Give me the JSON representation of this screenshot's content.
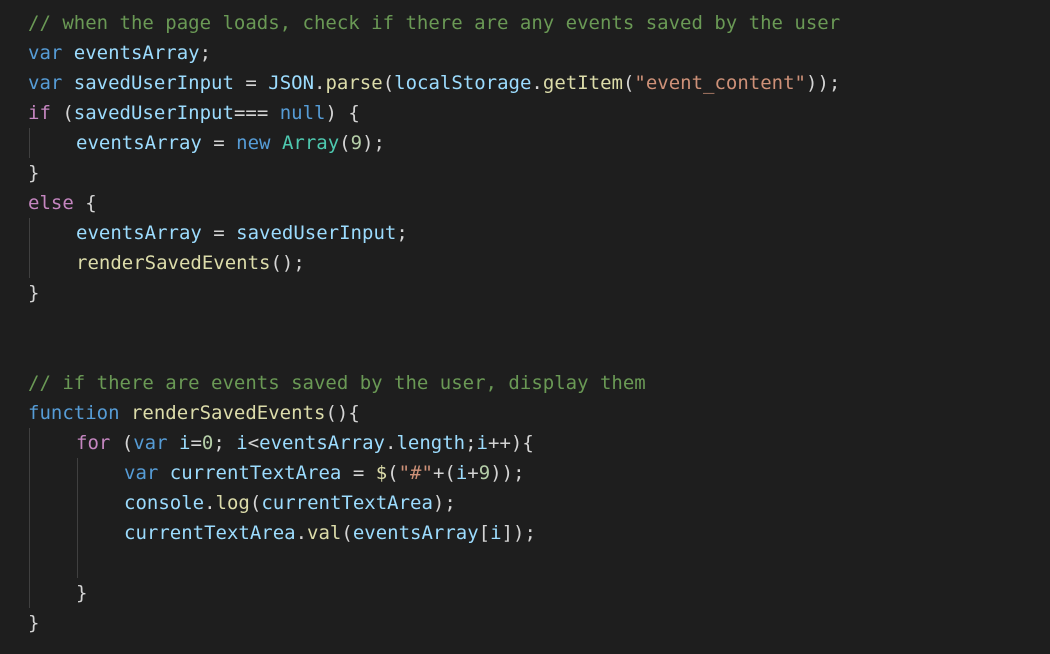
{
  "editor": {
    "theme": "dark",
    "colors": {
      "background": "#1e1e1e",
      "comment": "#6a9955",
      "keyword": "#569cd6",
      "control": "#c586c0",
      "variable": "#9cdcfe",
      "function": "#dcdcaa",
      "string": "#ce9178",
      "number": "#b5cea8",
      "class": "#4ec9b0",
      "punctuation": "#d4d4d4"
    },
    "lines": [
      {
        "tokens": [
          {
            "text": "// when the page loads, check if there are any events saved by the user",
            "type": "comment"
          }
        ]
      },
      {
        "tokens": [
          {
            "text": "var",
            "type": "keyword"
          },
          {
            "text": " ",
            "type": "punct"
          },
          {
            "text": "eventsArray",
            "type": "variable"
          },
          {
            "text": ";",
            "type": "punct"
          }
        ]
      },
      {
        "tokens": [
          {
            "text": "var",
            "type": "keyword"
          },
          {
            "text": " ",
            "type": "punct"
          },
          {
            "text": "savedUserInput",
            "type": "variable"
          },
          {
            "text": " = ",
            "type": "punct"
          },
          {
            "text": "JSON",
            "type": "variable"
          },
          {
            "text": ".",
            "type": "punct"
          },
          {
            "text": "parse",
            "type": "function"
          },
          {
            "text": "(",
            "type": "punct"
          },
          {
            "text": "localStorage",
            "type": "variable"
          },
          {
            "text": ".",
            "type": "punct"
          },
          {
            "text": "getItem",
            "type": "function"
          },
          {
            "text": "(",
            "type": "punct"
          },
          {
            "text": "\"event_content\"",
            "type": "string"
          },
          {
            "text": "));",
            "type": "punct"
          }
        ]
      },
      {
        "tokens": [
          {
            "text": "if",
            "type": "control"
          },
          {
            "text": " (",
            "type": "punct"
          },
          {
            "text": "savedUserInput",
            "type": "variable"
          },
          {
            "text": "=== ",
            "type": "punct"
          },
          {
            "text": "null",
            "type": "keyword"
          },
          {
            "text": ") {",
            "type": "punct"
          }
        ]
      },
      {
        "tokens": [
          {
            "text": "eventsArray",
            "type": "variable"
          },
          {
            "text": " = ",
            "type": "punct"
          },
          {
            "text": "new",
            "type": "keyword"
          },
          {
            "text": " ",
            "type": "punct"
          },
          {
            "text": "Array",
            "type": "class"
          },
          {
            "text": "(",
            "type": "punct"
          },
          {
            "text": "9",
            "type": "number"
          },
          {
            "text": ");",
            "type": "punct"
          }
        ]
      },
      {
        "tokens": [
          {
            "text": "}",
            "type": "punct"
          }
        ]
      },
      {
        "tokens": [
          {
            "text": "else",
            "type": "control"
          },
          {
            "text": " {",
            "type": "punct"
          }
        ]
      },
      {
        "tokens": [
          {
            "text": "eventsArray",
            "type": "variable"
          },
          {
            "text": " = ",
            "type": "punct"
          },
          {
            "text": "savedUserInput",
            "type": "variable"
          },
          {
            "text": ";",
            "type": "punct"
          }
        ]
      },
      {
        "tokens": [
          {
            "text": "renderSavedEvents",
            "type": "function"
          },
          {
            "text": "();",
            "type": "punct"
          }
        ]
      },
      {
        "tokens": [
          {
            "text": "}",
            "type": "punct"
          }
        ]
      },
      {
        "tokens": [
          {
            "text": "// if there are events saved by the user, display them",
            "type": "comment"
          }
        ]
      },
      {
        "tokens": [
          {
            "text": "function",
            "type": "keyword"
          },
          {
            "text": " ",
            "type": "punct"
          },
          {
            "text": "renderSavedEvents",
            "type": "function"
          },
          {
            "text": "(){",
            "type": "punct"
          }
        ]
      },
      {
        "tokens": [
          {
            "text": "for",
            "type": "control"
          },
          {
            "text": " (",
            "type": "punct"
          },
          {
            "text": "var",
            "type": "keyword"
          },
          {
            "text": " ",
            "type": "punct"
          },
          {
            "text": "i",
            "type": "variable"
          },
          {
            "text": "=",
            "type": "punct"
          },
          {
            "text": "0",
            "type": "number"
          },
          {
            "text": "; ",
            "type": "punct"
          },
          {
            "text": "i",
            "type": "variable"
          },
          {
            "text": "<",
            "type": "punct"
          },
          {
            "text": "eventsArray",
            "type": "variable"
          },
          {
            "text": ".",
            "type": "punct"
          },
          {
            "text": "length",
            "type": "variable"
          },
          {
            "text": ";",
            "type": "punct"
          },
          {
            "text": "i",
            "type": "variable"
          },
          {
            "text": "++){",
            "type": "punct"
          }
        ]
      },
      {
        "tokens": [
          {
            "text": "var",
            "type": "keyword"
          },
          {
            "text": " ",
            "type": "punct"
          },
          {
            "text": "currentTextArea",
            "type": "variable"
          },
          {
            "text": " = ",
            "type": "punct"
          },
          {
            "text": "$",
            "type": "function"
          },
          {
            "text": "(",
            "type": "punct"
          },
          {
            "text": "\"#\"",
            "type": "string"
          },
          {
            "text": "+(",
            "type": "punct"
          },
          {
            "text": "i",
            "type": "variable"
          },
          {
            "text": "+",
            "type": "punct"
          },
          {
            "text": "9",
            "type": "number"
          },
          {
            "text": "));",
            "type": "punct"
          }
        ]
      },
      {
        "tokens": [
          {
            "text": "console",
            "type": "variable"
          },
          {
            "text": ".",
            "type": "punct"
          },
          {
            "text": "log",
            "type": "function"
          },
          {
            "text": "(",
            "type": "punct"
          },
          {
            "text": "currentTextArea",
            "type": "variable"
          },
          {
            "text": ");",
            "type": "punct"
          }
        ]
      },
      {
        "tokens": [
          {
            "text": "currentTextArea",
            "type": "variable"
          },
          {
            "text": ".",
            "type": "punct"
          },
          {
            "text": "val",
            "type": "function"
          },
          {
            "text": "(",
            "type": "punct"
          },
          {
            "text": "eventsArray",
            "type": "variable"
          },
          {
            "text": "[",
            "type": "punct"
          },
          {
            "text": "i",
            "type": "variable"
          },
          {
            "text": "]);",
            "type": "punct"
          }
        ]
      },
      {
        "tokens": [
          {
            "text": "}",
            "type": "punct"
          }
        ]
      },
      {
        "tokens": [
          {
            "text": "}",
            "type": "punct"
          }
        ]
      }
    ]
  }
}
